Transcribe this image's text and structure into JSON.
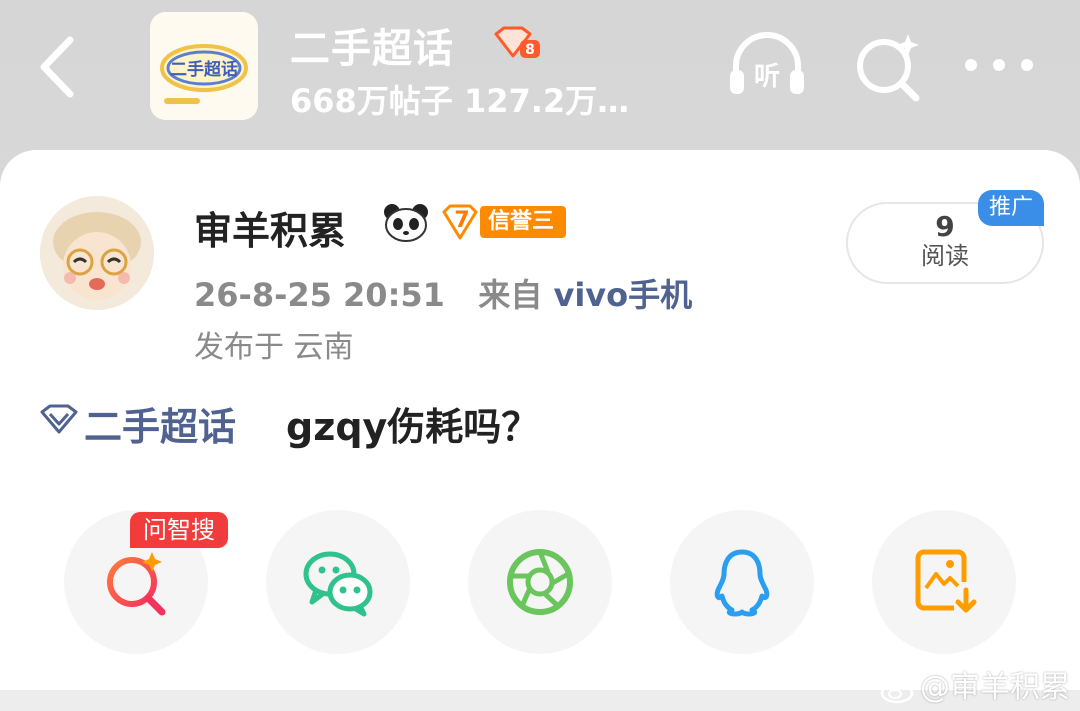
{
  "header": {
    "back_icon": "chevron-left-icon",
    "topic_name": "二手超话",
    "topic_badge_icon": "super-topic-badge-icon",
    "topic_stats": "668万帖子 127.2万…",
    "logo_text": "二手超话",
    "listen_label": "听",
    "search_icon": "ai-search-icon",
    "more_icon": "more-dots-icon"
  },
  "post": {
    "username": "审羊积累",
    "user_badge_icon": "panda-icon",
    "level_number": "7",
    "level_label": "信誉三",
    "time": "26-8-25 20:51",
    "from_label": "来自",
    "source": "vivo手机",
    "location": "发布于 云南",
    "read_count": "9",
    "read_label": "阅读",
    "promo_label": "推广",
    "topic_link": "二手超话",
    "content": "gzqy伤耗吗？"
  },
  "share": {
    "ai_tag": "问智搜",
    "items": [
      {
        "name": "ai-search",
        "icon": "ai-search-icon",
        "color": "#f5325c"
      },
      {
        "name": "wechat",
        "icon": "wechat-icon",
        "color": "#2fc28c"
      },
      {
        "name": "moments",
        "icon": "moments-icon",
        "color": "#6ac55c"
      },
      {
        "name": "qq",
        "icon": "qq-icon",
        "color": "#2a9ef0"
      },
      {
        "name": "save-image",
        "icon": "save-image-icon",
        "color": "#ff9d00"
      }
    ]
  },
  "watermark": {
    "text": "@审羊积累",
    "logo_icon": "weibo-logo-icon"
  },
  "colors": {
    "link": "#4f6290",
    "level_orange": "#ff8a00",
    "promo_blue": "#3a8ee8",
    "ai_red": "#f23b3b"
  }
}
